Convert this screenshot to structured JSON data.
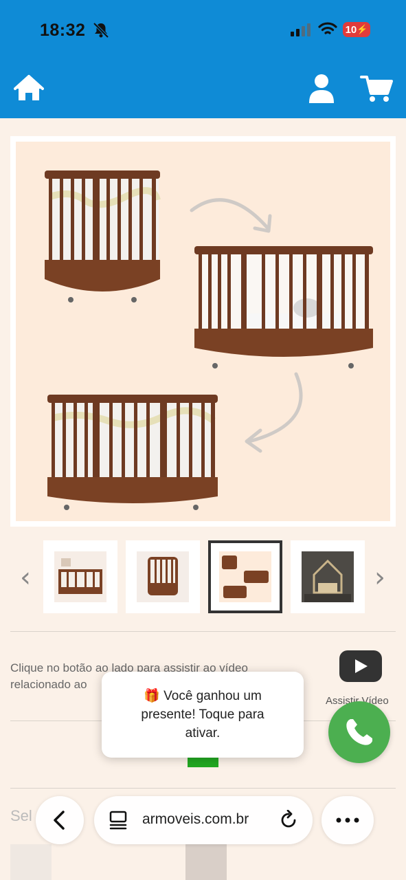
{
  "status": {
    "time": "18:32",
    "battery": "10"
  },
  "header": {
    "home_icon": "home-icon",
    "user_icon": "user-icon",
    "cart_icon": "cart-icon",
    "bg_color": "#0f8bd6"
  },
  "gallery": {
    "prev_glyph": "‹",
    "next_glyph": "›",
    "thumbnail_count": 4,
    "active_index": 2
  },
  "video": {
    "text_line1": "Clique no botão ao lado para assistir ao vídeo",
    "text_line2": "relacionado ao",
    "label": "Assistir Vídeo"
  },
  "toast": {
    "emoji": "🎁",
    "text": "Você ganhou um presente! Toque para ativar."
  },
  "select": {
    "label": "Sel"
  },
  "browser": {
    "url": "armoveis.com.br"
  },
  "colors": {
    "accent": "#0f8bd6",
    "whatsapp": "#4caf50",
    "cta_green": "#22a822",
    "background": "#fbf1e8"
  }
}
